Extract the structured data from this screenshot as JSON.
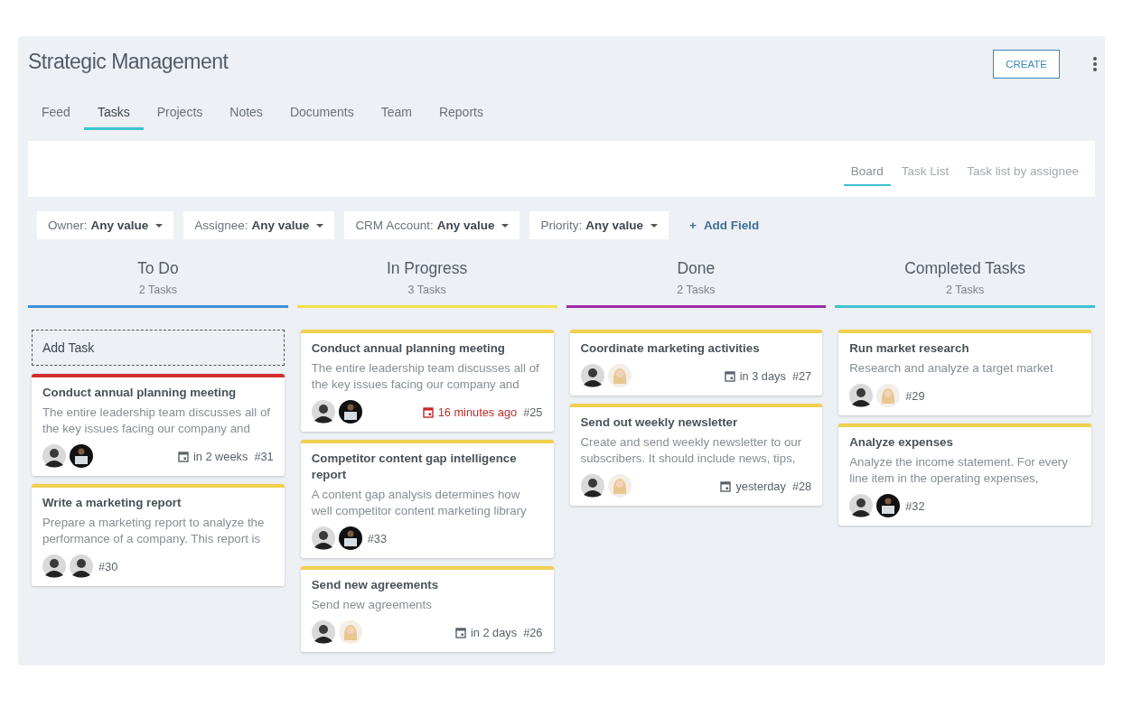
{
  "page": {
    "title": "Strategic Management",
    "create_button": "CREATE"
  },
  "tabs": [
    {
      "label": "Feed",
      "selected": false
    },
    {
      "label": "Tasks",
      "selected": true
    },
    {
      "label": "Projects",
      "selected": false
    },
    {
      "label": "Notes",
      "selected": false
    },
    {
      "label": "Documents",
      "selected": false
    },
    {
      "label": "Team",
      "selected": false
    },
    {
      "label": "Reports",
      "selected": false
    }
  ],
  "views": [
    {
      "label": "Board",
      "selected": true
    },
    {
      "label": "Task List",
      "selected": false
    },
    {
      "label": "Task list by assignee",
      "selected": false
    }
  ],
  "filters": [
    {
      "label": "Owner:",
      "value": "Any value"
    },
    {
      "label": "Assignee:",
      "value": "Any value"
    },
    {
      "label": "CRM Account:",
      "value": "Any value"
    },
    {
      "label": "Priority:",
      "value": "Any value"
    }
  ],
  "add_field": {
    "icon": "+",
    "label": "Add Field"
  },
  "columns": [
    {
      "title": "To Do",
      "count": "2 Tasks",
      "color": "#3d8fd6",
      "add_task": "Add Task",
      "cards": [
        {
          "title": "Conduct annual planning meeting",
          "description": "The entire leadership team discusses all of the key issues facing our company and",
          "color": "#d32f2f",
          "avatars": [
            {
              "kind": "man"
            },
            {
              "kind": "laptop"
            }
          ],
          "due": "in 2 weeks",
          "overdue": false,
          "number": "#31"
        },
        {
          "title": "Write a marketing report",
          "description": "Prepare a marketing report to analyze the performance of a company. This report is",
          "color": "#f0d050",
          "avatars": [
            {
              "kind": "man"
            },
            {
              "kind": "man"
            }
          ],
          "number": "#30"
        }
      ]
    },
    {
      "title": "In Progress",
      "count": "3 Tasks",
      "color": "#f2e14a",
      "cards": [
        {
          "title": "Conduct annual planning meeting",
          "description": "The entire leadership team discusses all of the key issues facing our company and",
          "color": "#f0d050",
          "avatars": [
            {
              "kind": "man"
            },
            {
              "kind": "laptop"
            }
          ],
          "due": "16 minutes ago",
          "overdue": true,
          "number": "#25"
        },
        {
          "title": "Competitor content gap intelligence report",
          "description": "A content gap analysis determines how well competitor content marketing library",
          "color": "#f0d050",
          "avatars": [
            {
              "kind": "man"
            },
            {
              "kind": "laptop"
            }
          ],
          "number": "#33"
        },
        {
          "title": "Send new agreements",
          "description": "Send new agreements",
          "color": "#f0d050",
          "avatars": [
            {
              "kind": "man"
            },
            {
              "kind": "woman"
            }
          ],
          "due": "in 2 days",
          "overdue": false,
          "number": "#26"
        }
      ]
    },
    {
      "title": "Done",
      "count": "2 Tasks",
      "color": "#9c2aa8",
      "cards": [
        {
          "title": "Coordinate marketing activities",
          "color": "#f0d050",
          "avatars": [
            {
              "kind": "man"
            },
            {
              "kind": "woman"
            }
          ],
          "due": "in 3 days",
          "overdue": false,
          "number": "#27"
        },
        {
          "title": "Send out weekly newsletter",
          "description": "Create and send weekly newsletter to our subscribers. It should include news, tips,",
          "color": "#f0d050",
          "avatars": [
            {
              "kind": "man"
            },
            {
              "kind": "woman"
            }
          ],
          "due": "yesterday",
          "overdue": false,
          "number": "#28"
        }
      ]
    },
    {
      "title": "Completed Tasks",
      "count": "2 Tasks",
      "color": "#3fc1cf",
      "cards": [
        {
          "title": "Run market research",
          "description": "Research and analyze a target market",
          "color": "#f0d050",
          "avatars": [
            {
              "kind": "man"
            },
            {
              "kind": "woman"
            }
          ],
          "number": "#29"
        },
        {
          "title": "Analyze expenses",
          "description": "Analyze the income statement. For every line item in the operating expenses,",
          "color": "#f0d050",
          "avatars": [
            {
              "kind": "man"
            },
            {
              "kind": "laptop"
            }
          ],
          "number": "#32"
        }
      ]
    }
  ]
}
